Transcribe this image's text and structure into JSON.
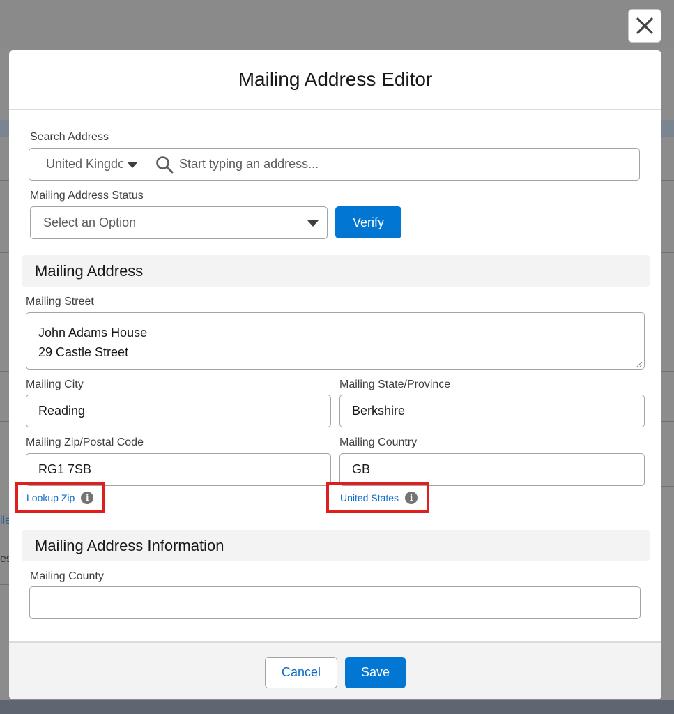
{
  "modal": {
    "title": "Mailing Address Editor",
    "close_icon": "close-icon"
  },
  "search": {
    "label": "Search Address",
    "country_value": "United Kingdom",
    "placeholder": "Start typing an address...",
    "search_icon": "search-icon"
  },
  "status": {
    "label": "Mailing Address Status",
    "placeholder": "Select an Option",
    "verify_label": "Verify"
  },
  "mailing_address": {
    "section_title": "Mailing Address",
    "street_label": "Mailing Street",
    "street_line1": "John Adams House",
    "street_line2": "29 Castle Street",
    "city_label": "Mailing City",
    "city_value": "Reading",
    "state_label": "Mailing State/Province",
    "state_value": "Berkshire",
    "zip_label": "Mailing Zip/Postal Code",
    "zip_value": "RG1 7SB",
    "country_label": "Mailing Country",
    "country_value": "GB",
    "lookup_zip_link": "Lookup Zip",
    "country_link": "United States",
    "info_icon": "info-icon"
  },
  "information": {
    "section_title": "Mailing Address Information",
    "county_label": "Mailing County",
    "county_value": ""
  },
  "footer": {
    "cancel_label": "Cancel",
    "save_label": "Save"
  },
  "background": {
    "frag_left_1": "ile",
    "frag_left_2": "es"
  },
  "colors": {
    "brand_blue": "#0176d3",
    "link_blue": "#0b6bcb",
    "highlight_red": "#e01e1e"
  }
}
